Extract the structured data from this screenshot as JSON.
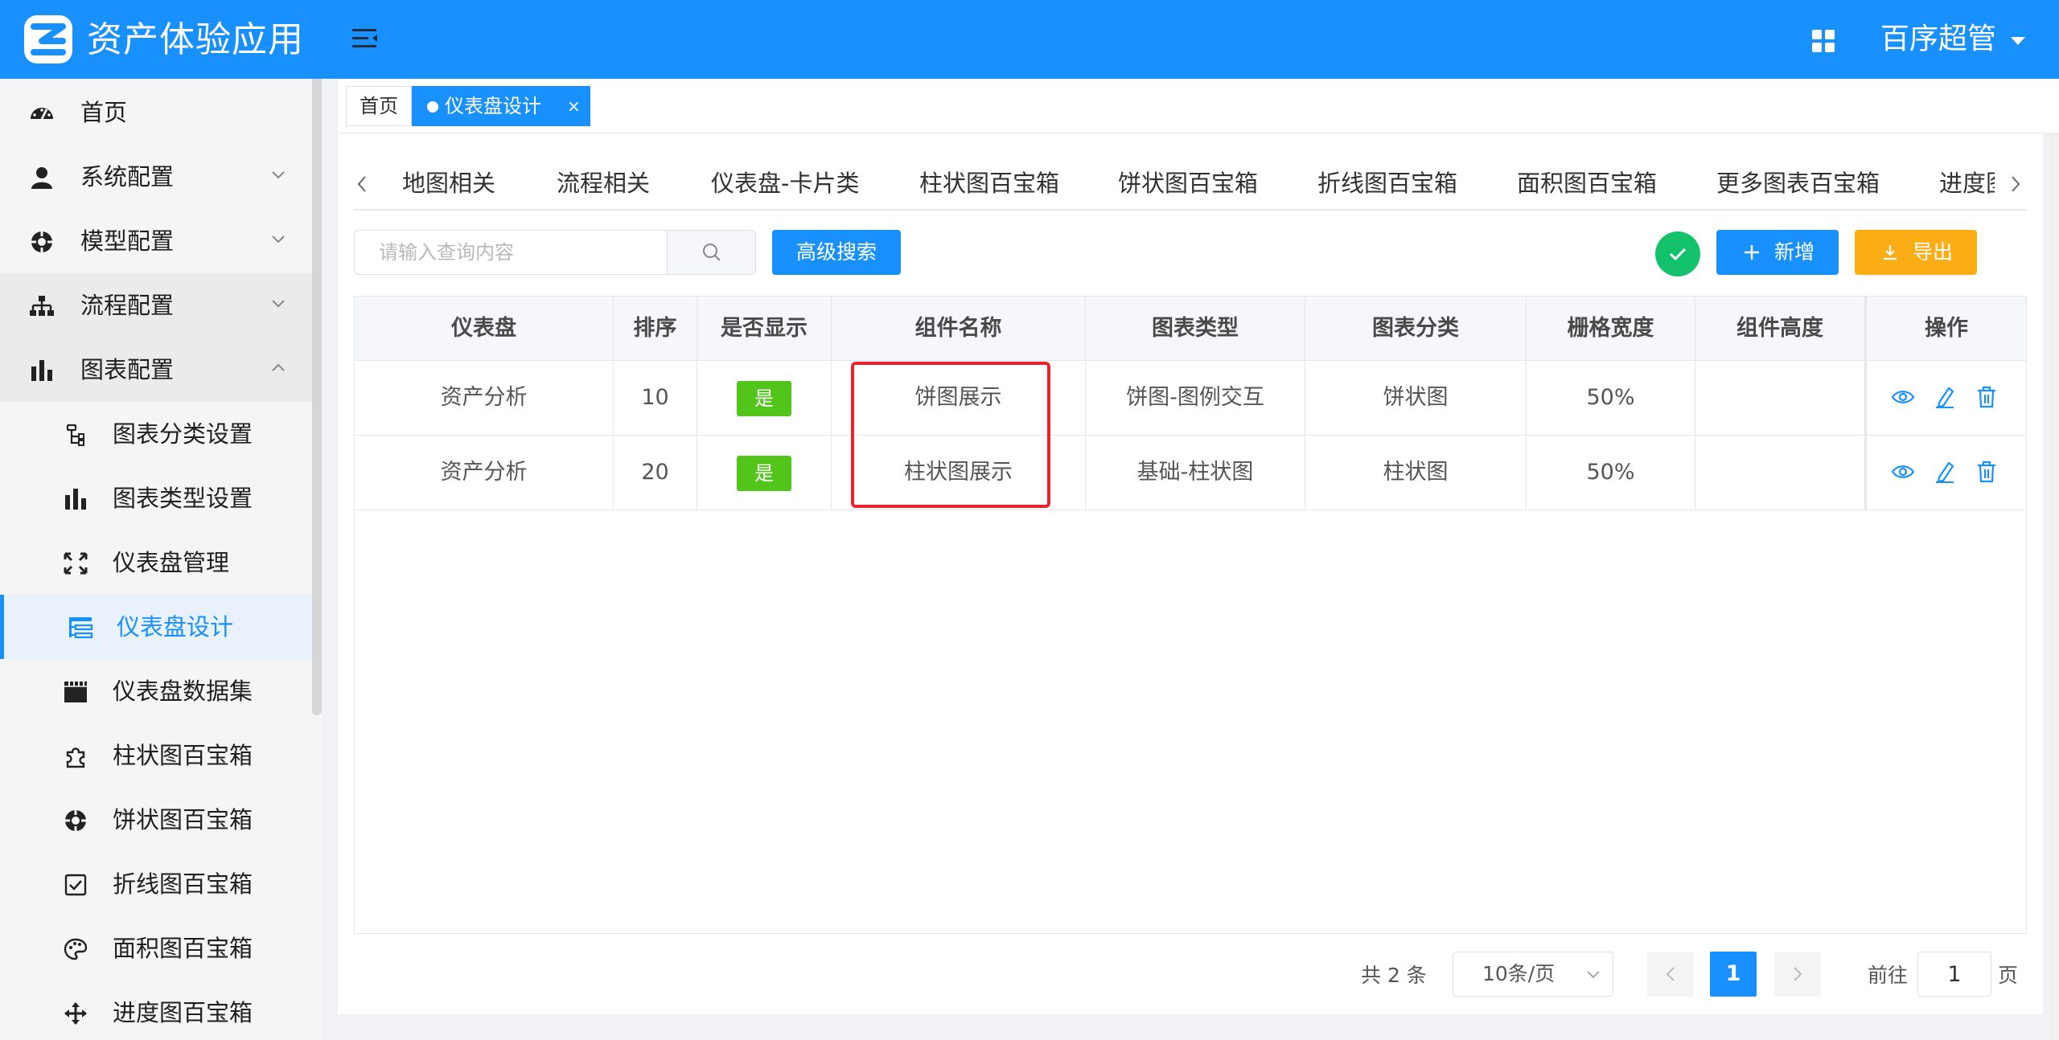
{
  "header": {
    "app_title": "资产体验应用",
    "user_name": "百序超管"
  },
  "sidebar": {
    "items": [
      {
        "label": "首页",
        "icon": "dashboard-icon"
      },
      {
        "label": "系统配置",
        "icon": "user-icon",
        "expandable": true
      },
      {
        "label": "模型配置",
        "icon": "lifebuoy-icon",
        "expandable": true
      },
      {
        "label": "流程配置",
        "icon": "sitemap-icon",
        "expandable": true
      },
      {
        "label": "图表配置",
        "icon": "bar-chart-icon",
        "expandable": true,
        "expanded": true
      },
      {
        "label": "图表分类设置",
        "icon": "tree-icon",
        "sub": true
      },
      {
        "label": "图表类型设置",
        "icon": "bar-chart-icon",
        "sub": true
      },
      {
        "label": "仪表盘管理",
        "icon": "expand-icon",
        "sub": true
      },
      {
        "label": "仪表盘设计",
        "icon": "list-tree-icon",
        "sub": true,
        "active": true
      },
      {
        "label": "仪表盘数据集",
        "icon": "film-icon",
        "sub": true
      },
      {
        "label": "柱状图百宝箱",
        "icon": "puzzle-icon",
        "sub": true
      },
      {
        "label": "饼状图百宝箱",
        "icon": "lifebuoy-icon",
        "sub": true
      },
      {
        "label": "折线图百宝箱",
        "icon": "checkbox-icon",
        "sub": true
      },
      {
        "label": "面积图百宝箱",
        "icon": "palette-icon",
        "sub": true
      },
      {
        "label": "进度图百宝箱",
        "icon": "move-icon",
        "sub": true
      }
    ]
  },
  "tabs": {
    "home": "首页",
    "active": "仪表盘设计",
    "close": "×"
  },
  "categories": [
    "地图相关",
    "流程相关",
    "仪表盘-卡片类",
    "柱状图百宝箱",
    "饼状图百宝箱",
    "折线图百宝箱",
    "面积图百宝箱",
    "更多图表百宝箱",
    "进度图"
  ],
  "toolbar": {
    "search_placeholder": "请输入查询内容",
    "advanced_search": "高级搜索",
    "add": "新增",
    "export": "导出"
  },
  "table": {
    "columns": [
      "仪表盘",
      "排序",
      "是否显示",
      "组件名称",
      "图表类型",
      "图表分类",
      "栅格宽度",
      "组件高度",
      "操作"
    ],
    "rows": [
      {
        "dashboard": "资产分析",
        "order": "10",
        "visible": "是",
        "component": "饼图展示",
        "chart_type": "饼图-图例交互",
        "category": "饼状图",
        "width": "50%",
        "height": ""
      },
      {
        "dashboard": "资产分析",
        "order": "20",
        "visible": "是",
        "component": "柱状图展示",
        "chart_type": "基础-柱状图",
        "category": "柱状图",
        "width": "50%",
        "height": ""
      }
    ]
  },
  "pagination": {
    "total": "共 2 条",
    "page_size": "10条/页",
    "current": "1",
    "goto_label": "前往",
    "goto_value": "1",
    "page_suffix": "页"
  },
  "colors": {
    "primary": "#1890ff",
    "success": "#52c41a",
    "warning": "#faad14",
    "highlight": "#e8232b"
  }
}
